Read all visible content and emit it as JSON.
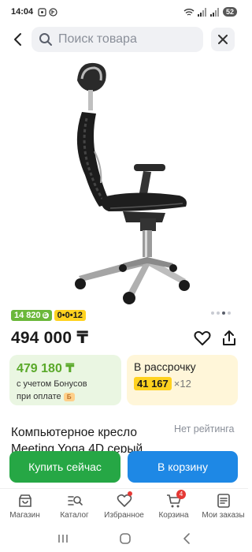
{
  "status_bar": {
    "time": "14:04",
    "battery": "52"
  },
  "search": {
    "placeholder": "Поиск товара"
  },
  "badges": {
    "bonus": "14 820",
    "installment": "0•0•12"
  },
  "product": {
    "price": "494 000 ₸",
    "title": "Компьютерное кресло Meeting Yoga 4D серый",
    "rating": "Нет рейтинга"
  },
  "bonus_card": {
    "amount": "479 180 ₸",
    "line1": "с учетом Бонусов",
    "line2": "при оплате"
  },
  "installment_card": {
    "title": "В рассрочку",
    "monthly": "41 167",
    "months": "×12"
  },
  "actions": {
    "buy_now": "Купить сейчас",
    "add_to_cart": "В корзину"
  },
  "bottom_nav": {
    "items": [
      {
        "label": "Магазин",
        "icon": "shop-icon"
      },
      {
        "label": "Каталог",
        "icon": "catalog-icon"
      },
      {
        "label": "Избранное",
        "icon": "heart-icon"
      },
      {
        "label": "Корзина",
        "icon": "cart-icon",
        "count": "4"
      },
      {
        "label": "Мои заказы",
        "icon": "orders-icon"
      }
    ]
  },
  "colors": {
    "green": "#26a745",
    "blue": "#1e88e5",
    "yellow": "#ffd21f",
    "bonus_green": "#6bb83a"
  }
}
